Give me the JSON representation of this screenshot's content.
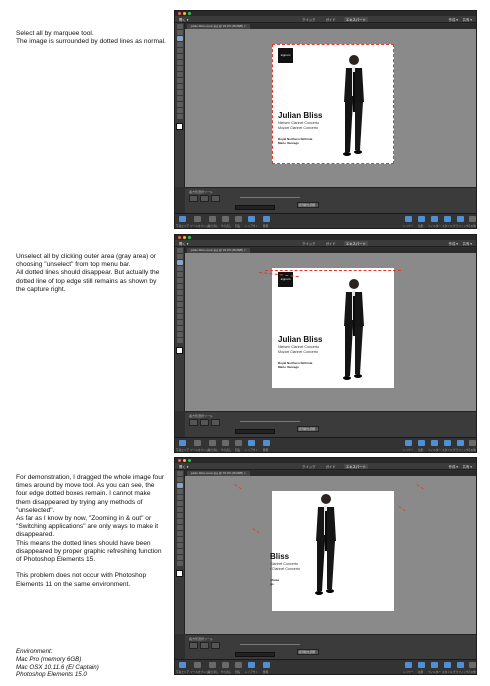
{
  "notes": {
    "note1": "Select all by marquee tool.\nThe image is surrounded by dotted lines as normal.",
    "note2": "Unselect all by clicking outer area (gray area) or choosing \"unselect\" from top menu bar.\nAll dotted lines should disappear. But actually the dotted line of top edge still remains as shown by the capture right.",
    "note3": "For demonstration, I dragged the whole image four times around by move tool. As you can see, the four edge dotted boxes remain. I cannot make them disappeared by trying any methods of \"unselected\".\nAs far as I know by now, \"Zooming in & out\" or \"Switching applications\" are only ways to make it disappeared.\nThis means the dotted lines should have been disappeared by proper graphic refreshing function of Photoshop Elements 15.\n\nThis problem does not occur with Photoshop Elements 11 on the same environment.",
    "environment": "Environment:\nMac Pro (memory 6GB)\nMac OSX 10.11.6 (El Captain)\nPhotoshop Elements 15.0"
  },
  "app": {
    "open_label": "開く ▾",
    "modes": [
      "クイック",
      "ガイド",
      "エキスパート"
    ],
    "active_mode": "エキスパート",
    "create_label": "作成 ▾",
    "share_label": "共有 ▾",
    "doc_tab": "julian-bliss-cover.jpg @ 33.3% (RGB/8) ×",
    "options_label": "長方形選択ツール",
    "options_button": "境界線を調整...",
    "taskbar": [
      "写真エリア",
      "ツールオプション",
      "取り消し",
      "やり直し",
      "回転",
      "レイアウト",
      "整理"
    ],
    "taskbar_right": [
      "レイヤー",
      "効果",
      "フィルター",
      "スタイル",
      "グラフィック",
      "その他"
    ]
  },
  "cover": {
    "logo": "signum",
    "artist": "Julian Bliss",
    "works": [
      "Nielsen Clarinet Concerto",
      "Mozart Clarinet Concerto"
    ],
    "orchestra": [
      "Royal Northern Sinfonia",
      "Mario Venzago"
    ],
    "artist_partial": "Bliss",
    "works_partial": [
      "Clarinet Concerto",
      "t Clarinet Concerto"
    ],
    "orchestra_partial": [
      "nfonia",
      "go"
    ]
  },
  "colors": {
    "marquee": "#e03a2e",
    "canvas": "#8a8a8a",
    "ui_dark": "#2f2f2f"
  }
}
